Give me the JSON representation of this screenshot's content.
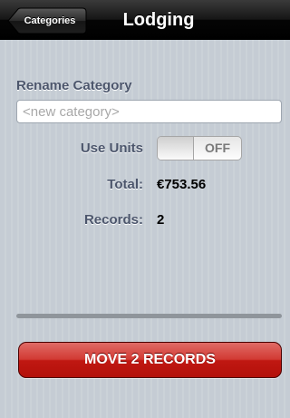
{
  "navbar": {
    "back_label": "Categories",
    "title": "Lodging"
  },
  "rename": {
    "label": "Rename Category",
    "placeholder": "<new category>",
    "value": ""
  },
  "use_units": {
    "label": "Use Units",
    "state": "OFF"
  },
  "total": {
    "label": "Total:",
    "value": "€753.56"
  },
  "records": {
    "label": "Records:",
    "value": "2"
  },
  "move_button": {
    "label": "MOVE 2 RECORDS"
  },
  "colors": {
    "navbar": "#000000",
    "background": "#c5ccd4",
    "label_text": "#4c566c",
    "move_button": "#c01812"
  }
}
